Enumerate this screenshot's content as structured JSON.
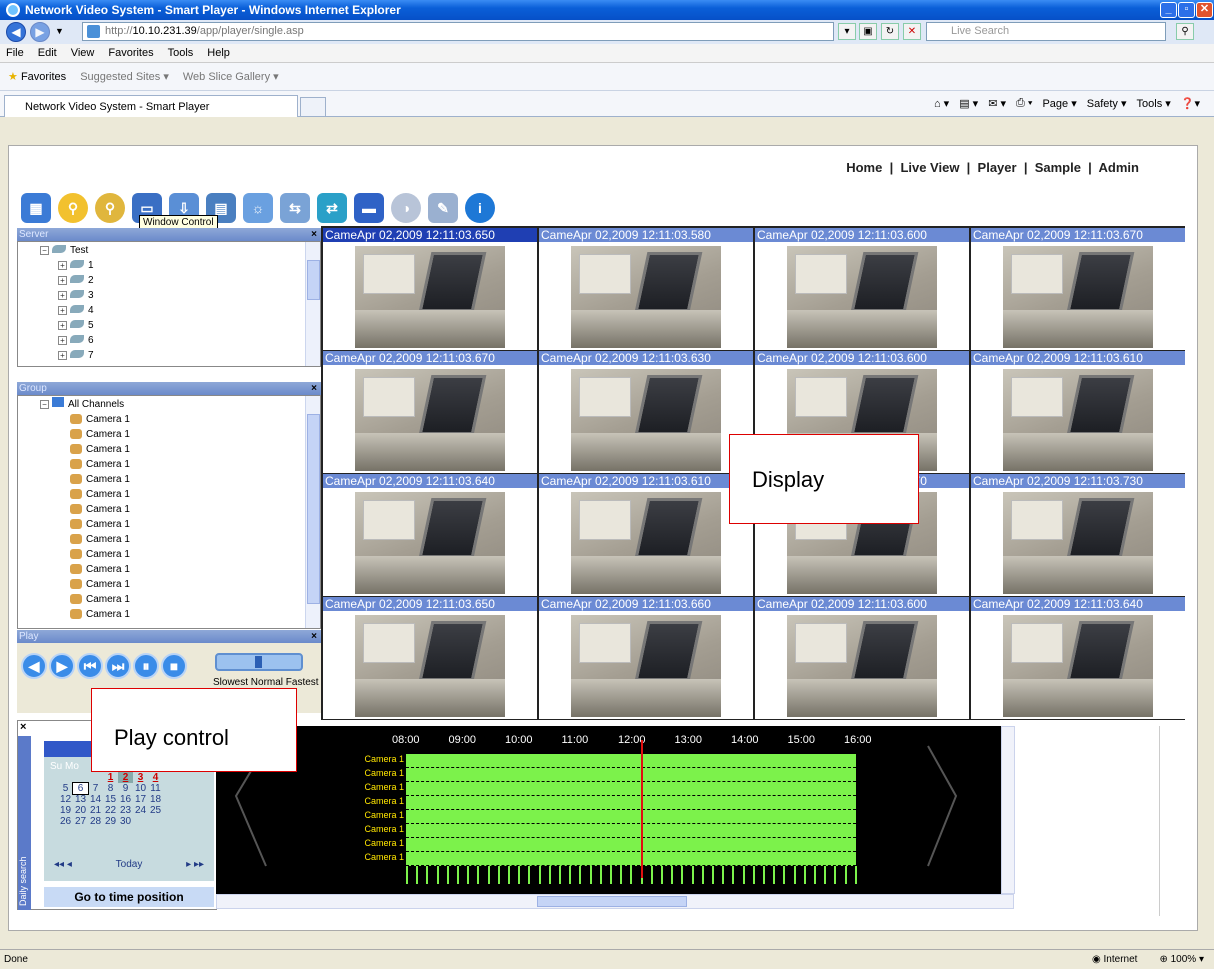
{
  "window": {
    "title": "Network Video System - Smart Player - Windows Internet Explorer"
  },
  "address": {
    "url_prefix": "http://",
    "url_host": "10.10.231.39",
    "url_path": "/app/player/single.asp",
    "search_placeholder": "Live Search"
  },
  "menu": [
    "File",
    "Edit",
    "View",
    "Favorites",
    "Tools",
    "Help"
  ],
  "favbar": {
    "favorites": "Favorites",
    "suggested": "Suggested Sites ▾",
    "webslice": "Web Slice Gallery ▾"
  },
  "tabs": {
    "active": "Network Video System - Smart Player"
  },
  "cmdbar": [
    "Page ▾",
    "Safety ▾",
    "Tools ▾"
  ],
  "site_nav": {
    "home": "Home",
    "live": "Live View",
    "player": "Player",
    "sample": "Sample",
    "admin": "Admin"
  },
  "tooltip": "Window Control",
  "server_panel": {
    "title": "Server",
    "root": "Test",
    "nodes": [
      "1",
      "2",
      "3",
      "4",
      "5",
      "6",
      "7"
    ]
  },
  "group_panel": {
    "title": "Group",
    "root": "All Channels",
    "cameras": [
      "Camera 1",
      "Camera 1",
      "Camera 1",
      "Camera 1",
      "Camera 1",
      "Camera 1",
      "Camera 1",
      "Camera 1",
      "Camera 1",
      "Camera 1",
      "Camera 1",
      "Camera 1",
      "Camera 1",
      "Camera 1"
    ]
  },
  "play_panel": {
    "title": "Play",
    "speed_labels": "Slowest Normal Fastest"
  },
  "video_cells": [
    "CameApr 02,2009 12:11:03.650",
    "CameApr 02,2009 12:11:03.580",
    "CameApr 02,2009 12:11:03.600",
    "CameApr 02,2009 12:11:03.670",
    "CameApr 02,2009 12:11:03.670",
    "CameApr 02,2009 12:11:03.630",
    "CameApr 02,2009 12:11:03.600",
    "CameApr 02,2009 12:11:03.610",
    "CameApr 02,2009 12:11:03.640",
    "CameApr 02,2009 12:11:03.610",
    "CameApr 02,2009 12:11:03.670",
    "CameApr 02,2009 12:11:03.730",
    "CameApr 02,2009 12:11:03.650",
    "CameApr 02,2009 12:11:03.660",
    "CameApr 02,2009 12:11:03.600",
    "CameApr 02,2009 12:11:03.640"
  ],
  "callouts": {
    "display": "Display",
    "play": "Play control"
  },
  "timeline": {
    "hours": [
      "08:00",
      "09:00",
      "10:00",
      "11:00",
      "12:00",
      "13:00",
      "14:00",
      "15:00",
      "16:00"
    ],
    "cameras": [
      "Camera 1",
      "Camera 1",
      "Camera 1",
      "Camera 1",
      "Camera 1",
      "Camera 1",
      "Camera 1",
      "Camera 1"
    ]
  },
  "calendar": {
    "weekday_head": "Su  Mo",
    "rows": [
      [
        "",
        "",
        "",
        "1",
        "2",
        "3",
        "4"
      ],
      [
        "5",
        "6",
        "7",
        "8",
        "9",
        "10",
        "11"
      ],
      [
        "12",
        "13",
        "14",
        "15",
        "16",
        "17",
        "18"
      ],
      [
        "19",
        "20",
        "21",
        "22",
        "23",
        "24",
        "25"
      ],
      [
        "26",
        "27",
        "28",
        "29",
        "30",
        "",
        ""
      ]
    ],
    "today": "Today",
    "goto": "Go to time position",
    "daily_search": "Daily search"
  },
  "status": {
    "left": "Done",
    "zone": "Internet",
    "zoom": "100%"
  }
}
